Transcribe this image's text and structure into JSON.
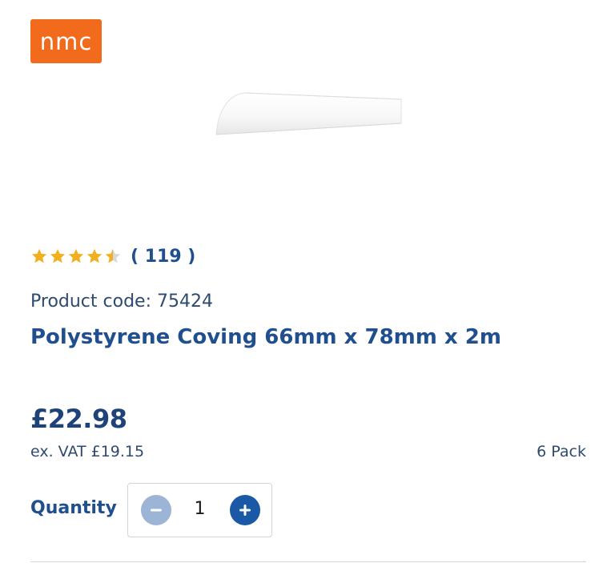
{
  "brand": {
    "logo_text": "nmc",
    "color": "#f26b1d"
  },
  "product": {
    "image_icon": "coving-profile-image",
    "rating": {
      "value": 4.5,
      "max": 5,
      "count_label": "( 119 )",
      "star_color": "#f2b01e"
    },
    "code_label": "Product code: 75424",
    "title": "Polystyrene Coving 66mm x 78mm x 2m",
    "price": "£22.98",
    "ex_vat": "ex. VAT £19.15",
    "pack_size": "6 Pack"
  },
  "quantity": {
    "label": "Quantity",
    "value": "1",
    "minus_icon": "minus-icon",
    "plus_icon": "plus-icon",
    "minus_color": "#9cb4d6",
    "plus_color": "#1959a6"
  }
}
